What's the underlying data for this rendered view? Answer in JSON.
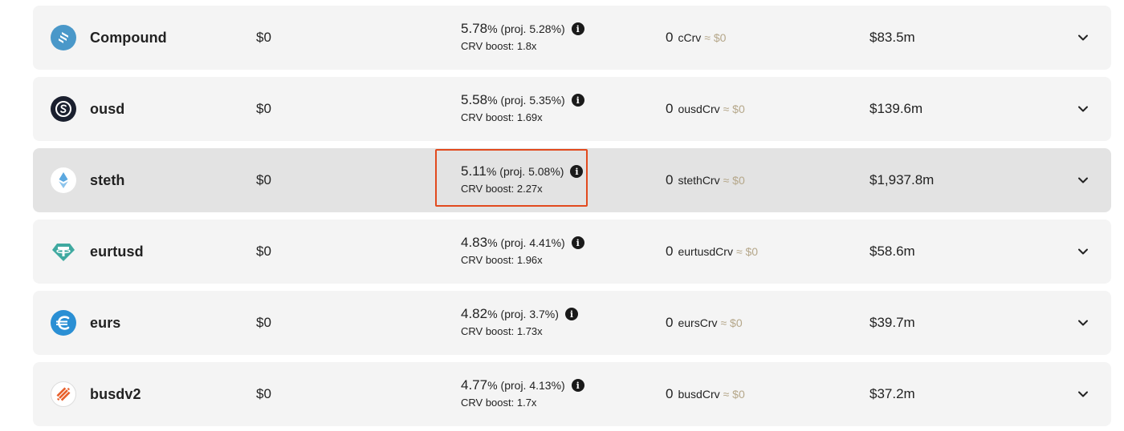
{
  "colors": {
    "row_bg": "#f4f4f4",
    "row_highlight_bg": "#e3e3e3",
    "highlight_border": "#e24a1e",
    "muted_text": "#b5a78a"
  },
  "pools": [
    {
      "name": "Compound",
      "icon": "compound-icon",
      "balance": "$0",
      "apy": "5.78",
      "apy_unit": "%",
      "proj": "(proj. 5.28%)",
      "boost": "CRV boost: 1.8x",
      "rewards_amount": "0",
      "rewards_token": "cCrv",
      "rewards_value": "≈ $0",
      "tvl": "$83.5m",
      "highlighted": false
    },
    {
      "name": "ousd",
      "icon": "ousd-icon",
      "balance": "$0",
      "apy": "5.58",
      "apy_unit": "%",
      "proj": "(proj. 5.35%)",
      "boost": "CRV boost: 1.69x",
      "rewards_amount": "0",
      "rewards_token": "ousdCrv",
      "rewards_value": "≈ $0",
      "tvl": "$139.6m",
      "highlighted": false
    },
    {
      "name": "steth",
      "icon": "steth-icon",
      "balance": "$0",
      "apy": "5.11",
      "apy_unit": "%",
      "proj": "(proj. 5.08%)",
      "boost": "CRV boost: 2.27x",
      "rewards_amount": "0",
      "rewards_token": "stethCrv",
      "rewards_value": "≈ $0",
      "tvl": "$1,937.8m",
      "highlighted": true
    },
    {
      "name": "eurtusd",
      "icon": "tether-icon",
      "balance": "$0",
      "apy": "4.83",
      "apy_unit": "%",
      "proj": "(proj. 4.41%)",
      "boost": "CRV boost: 1.96x",
      "rewards_amount": "0",
      "rewards_token": "eurtusdCrv",
      "rewards_value": "≈ $0",
      "tvl": "$58.6m",
      "highlighted": false
    },
    {
      "name": "eurs",
      "icon": "eurs-icon",
      "balance": "$0",
      "apy": "4.82",
      "apy_unit": "%",
      "proj": "(proj. 3.7%)",
      "boost": "CRV boost: 1.73x",
      "rewards_amount": "0",
      "rewards_token": "eursCrv",
      "rewards_value": "≈ $0",
      "tvl": "$39.7m",
      "highlighted": false
    },
    {
      "name": "busdv2",
      "icon": "busd-icon",
      "balance": "$0",
      "apy": "4.77",
      "apy_unit": "%",
      "proj": "(proj. 4.13%)",
      "boost": "CRV boost: 1.7x",
      "rewards_amount": "0",
      "rewards_token": "busdCrv",
      "rewards_value": "≈ $0",
      "tvl": "$37.2m",
      "highlighted": false
    }
  ]
}
